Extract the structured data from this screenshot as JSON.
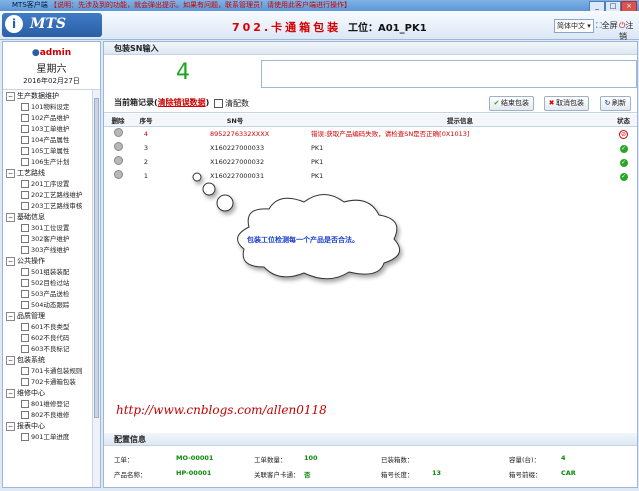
{
  "window": {
    "app": "MTS客户端",
    "notice": "【说明：先涉及到的功能，就会弹出提示。如果有问题，联系管理员！请使用此客户端进行操作】",
    "min_label": "_",
    "max_label": "□",
    "close_label": "×"
  },
  "header": {
    "logo_text": "MTS",
    "station_name": "702.卡通箱包装",
    "station_code": "工位：A01_PK1",
    "language": "简体中文",
    "fullscreen_label": "全屏",
    "logout_label": "注销"
  },
  "user": {
    "name": "admin",
    "weekday": "星期六",
    "date": "2016年02月27日"
  },
  "sidebar": {
    "groups": [
      {
        "label": "生产数据维护",
        "items": [
          "101物料设定",
          "102产品维护",
          "103工单维护",
          "104产品属性",
          "105工单属性",
          "106生产计划"
        ]
      },
      {
        "label": "工艺路线",
        "items": [
          "201工序设置",
          "202工艺路线维护",
          "203工艺路线审核"
        ]
      },
      {
        "label": "基础信息",
        "items": [
          "301工位设置",
          "302客户维护",
          "303产线维护"
        ]
      },
      {
        "label": "公共操作",
        "items": [
          "501组装装配",
          "502目检过站",
          "503产品送检",
          "504动态跟踪"
        ]
      },
      {
        "label": "品质管理",
        "items": [
          "601不良类型",
          "602不良代码",
          "603不良标记"
        ]
      },
      {
        "label": "包装系统",
        "items": [
          "701卡通包装规则",
          "702卡通箱包装"
        ]
      },
      {
        "label": "维修中心",
        "items": [
          "801维修登记",
          "802不良维修"
        ]
      },
      {
        "label": "报表中心",
        "items": [
          "901工单进度"
        ]
      }
    ]
  },
  "main": {
    "input_section_title": "包装SN输入",
    "packed_count": "4",
    "sn_input_value": "",
    "record_title": "当前箱记录",
    "clear_error_link": "清除错误数据",
    "clear_count_label": "清配数",
    "buttons": {
      "finish_pack": "结束包装",
      "cancel_pack": "取消包装",
      "refresh": "刷新"
    },
    "table": {
      "headers": [
        "删除",
        "序号",
        "SN号",
        "提示信息",
        "状态"
      ],
      "rows": [
        {
          "seq": "4",
          "sn": "8952276332XXXX",
          "msg": "错误:获取产品编码失败，请检查SN是否正确[0X1013]",
          "status": "ng"
        },
        {
          "seq": "3",
          "sn": "X160227000033",
          "msg": "PK1",
          "status": "ok"
        },
        {
          "seq": "2",
          "sn": "X160227000032",
          "msg": "PK1",
          "status": "ok"
        },
        {
          "seq": "1",
          "sn": "X160227000031",
          "msg": "PK1",
          "status": "ok"
        }
      ]
    },
    "callout_text": "包装工位检测每一个产品是否合法。",
    "watermark": "http://www.cnblogs.com/allen0118"
  },
  "config": {
    "title": "配置信息",
    "fields": {
      "work_order_label": "工单：",
      "work_order": "MO-00001",
      "order_qty_label": "工单数量：",
      "order_qty": "100",
      "packed_label": "已装箱数：",
      "packed": "",
      "capacity_label": "容量(台)：",
      "capacity": "4",
      "product_label": "产品名称：",
      "product": "HP-00001",
      "customer_label": "关联客户卡通：",
      "customer": "否",
      "box_len_label": "箱号长度：",
      "box_len": "13",
      "box_prefix_label": "箱号前缀：",
      "box_prefix": "CAR"
    }
  },
  "colors": {
    "accent": "#2b5ea5",
    "error": "#d40000",
    "ok": "#2aa52a"
  }
}
